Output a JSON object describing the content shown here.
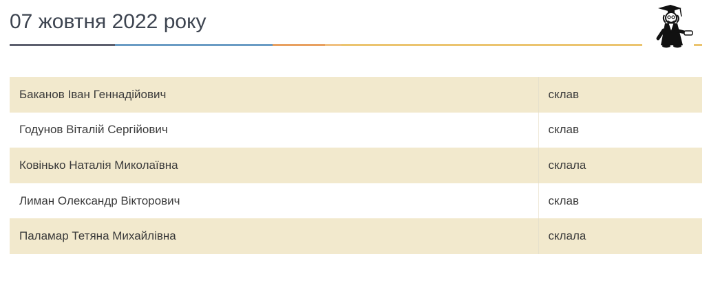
{
  "header": {
    "title": "07 жовтня 2022 року",
    "mascot_icon": "professor-graduate-icon",
    "rule_colors": [
      "#5c5f6e",
      "#6a9cc4",
      "#e8a060",
      "#f0c080",
      "#ebc46f",
      "#ebc46f"
    ]
  },
  "table": {
    "rows": [
      {
        "name": "Баканов Іван Геннадійович",
        "status": "склав"
      },
      {
        "name": "Годунов Віталій Сергійович",
        "status": "склав"
      },
      {
        "name": "Ковінько Наталія Миколаївна",
        "status": "склала"
      },
      {
        "name": "Лиман Олександр Вікторович",
        "status": "склав"
      },
      {
        "name": "Паламар Тетяна Михайлівна",
        "status": "склала"
      }
    ],
    "stripe_color": "#f2e9cd"
  }
}
